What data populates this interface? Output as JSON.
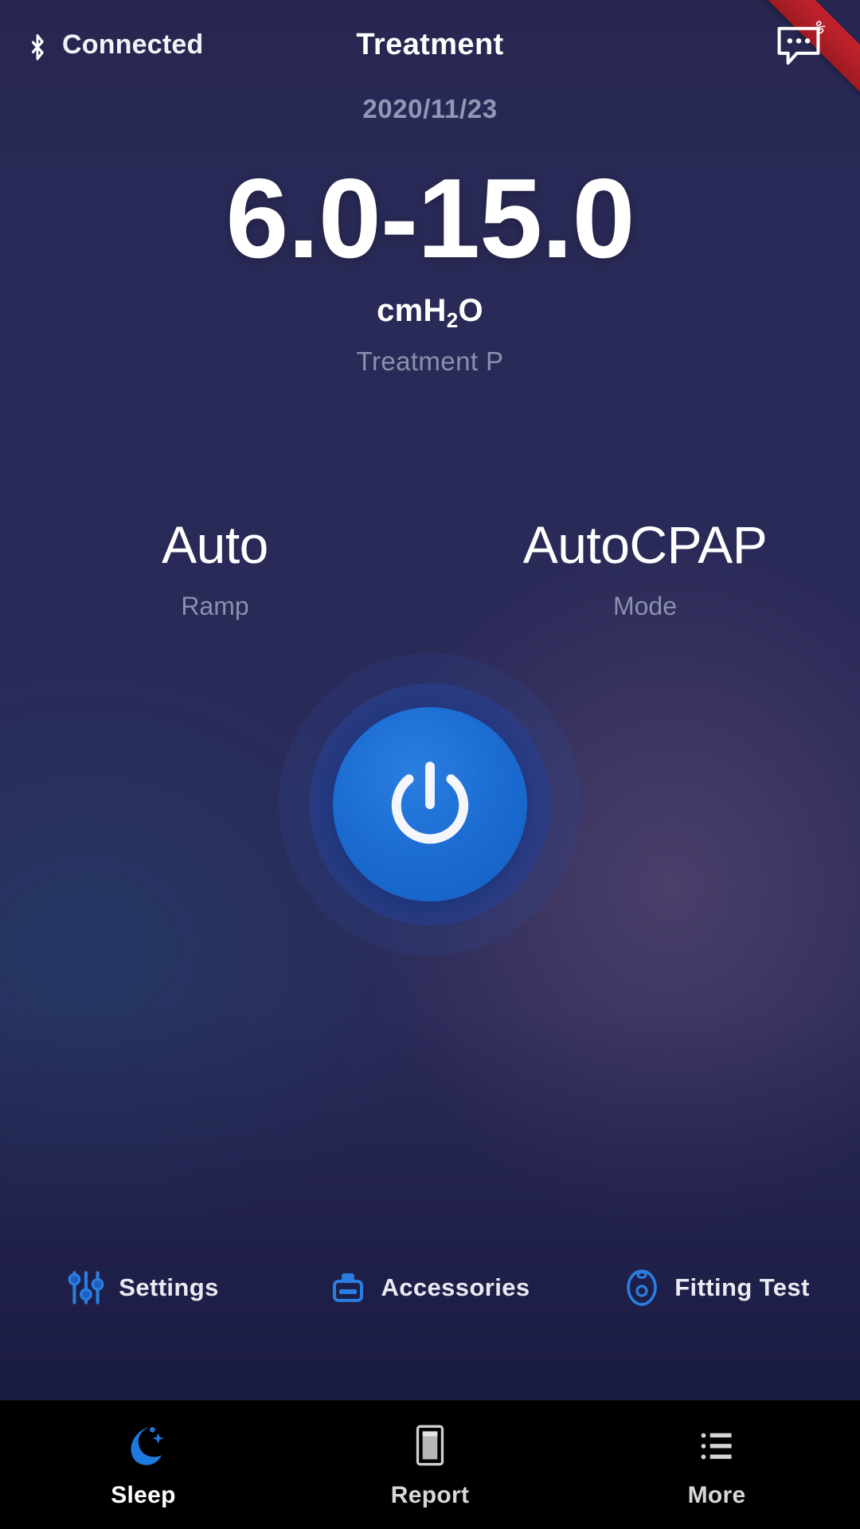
{
  "header": {
    "bluetooth_icon": "bluetooth-icon",
    "bluetooth_status": "Connected",
    "title": "Treatment",
    "message_icon": "message-bubble-icon"
  },
  "ribbon": {
    "text": "%",
    "color": "#c4232c"
  },
  "readout": {
    "date": "2020/11/23",
    "pressure_value": "6.0-15.0",
    "unit_prefix": "cmH",
    "unit_sub": "2",
    "unit_suffix": "O",
    "caption": "Treatment P"
  },
  "stats": [
    {
      "value": "Auto",
      "label": "Ramp"
    },
    {
      "value": "AutoCPAP",
      "label": "Mode"
    }
  ],
  "power": {
    "icon": "power-icon",
    "accent": "#1a6ad0"
  },
  "actions": [
    {
      "icon": "sliders-icon",
      "label": "Settings"
    },
    {
      "icon": "humidifier-icon",
      "label": "Accessories"
    },
    {
      "icon": "mask-icon",
      "label": "Fitting Test"
    }
  ],
  "tabs": [
    {
      "icon": "moon-star-icon",
      "label": "Sleep",
      "active": true
    },
    {
      "icon": "report-document-icon",
      "label": "Report",
      "active": false
    },
    {
      "icon": "list-menu-icon",
      "label": "More",
      "active": false
    }
  ],
  "colors": {
    "accent_blue": "#1a6ad0",
    "muted_text": "#8a90ad",
    "nav_bg": "#000000"
  }
}
